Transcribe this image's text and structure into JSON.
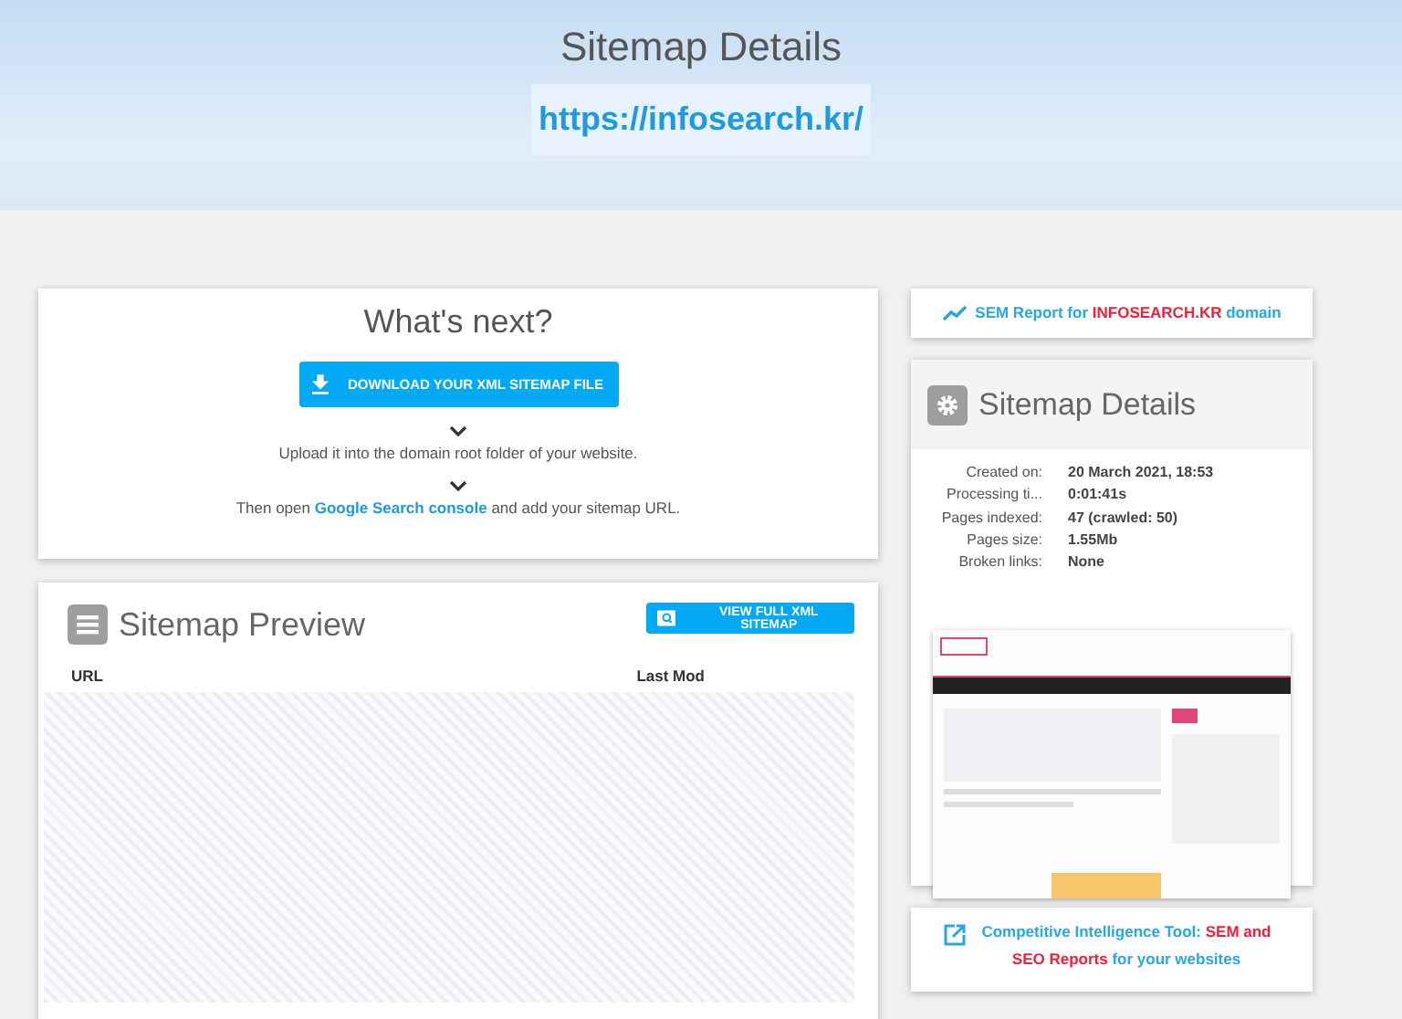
{
  "header": {
    "title": "Sitemap Details",
    "url": "https://infosearch.kr/"
  },
  "whats_next": {
    "title": "What's next?",
    "download_button": "DOWNLOAD YOUR XML SITEMAP FILE",
    "step_1": "Upload it into the domain root folder of your website.",
    "step_2_before": "Then open ",
    "step_2_link": "Google Search console",
    "step_2_after": " and add your sitemap URL."
  },
  "preview": {
    "title": "Sitemap Preview",
    "view_button": "VIEW FULL XML SITEMAP",
    "columns": [
      "URL",
      "Last Mod"
    ]
  },
  "sem_link": {
    "parts": [
      {
        "text": "SEM Report for ",
        "kind": "plain"
      },
      {
        "text": "INFOSEARCH.KR",
        "kind": "highlight"
      },
      {
        "text": " domain",
        "kind": "plain"
      }
    ]
  },
  "details": {
    "title": "Sitemap Details",
    "rows": [
      {
        "label": "Created on:",
        "value": "20 March 2021, 18:53"
      },
      {
        "label": "Processing ti...",
        "value": "0:01:41s"
      },
      {
        "label": "Pages indexed:",
        "value": "47 (crawled: 50)"
      },
      {
        "label": "Pages size:",
        "value": "1.55Mb"
      },
      {
        "label": "Broken links:",
        "value": "None"
      }
    ]
  },
  "tool_link": {
    "parts": [
      {
        "text": "Competitive Intelligence Tool: ",
        "kind": "plain"
      },
      {
        "text": "SEM and SEO Reports",
        "kind": "highlight"
      },
      {
        "text": " for your websites",
        "kind": "plain"
      }
    ]
  }
}
